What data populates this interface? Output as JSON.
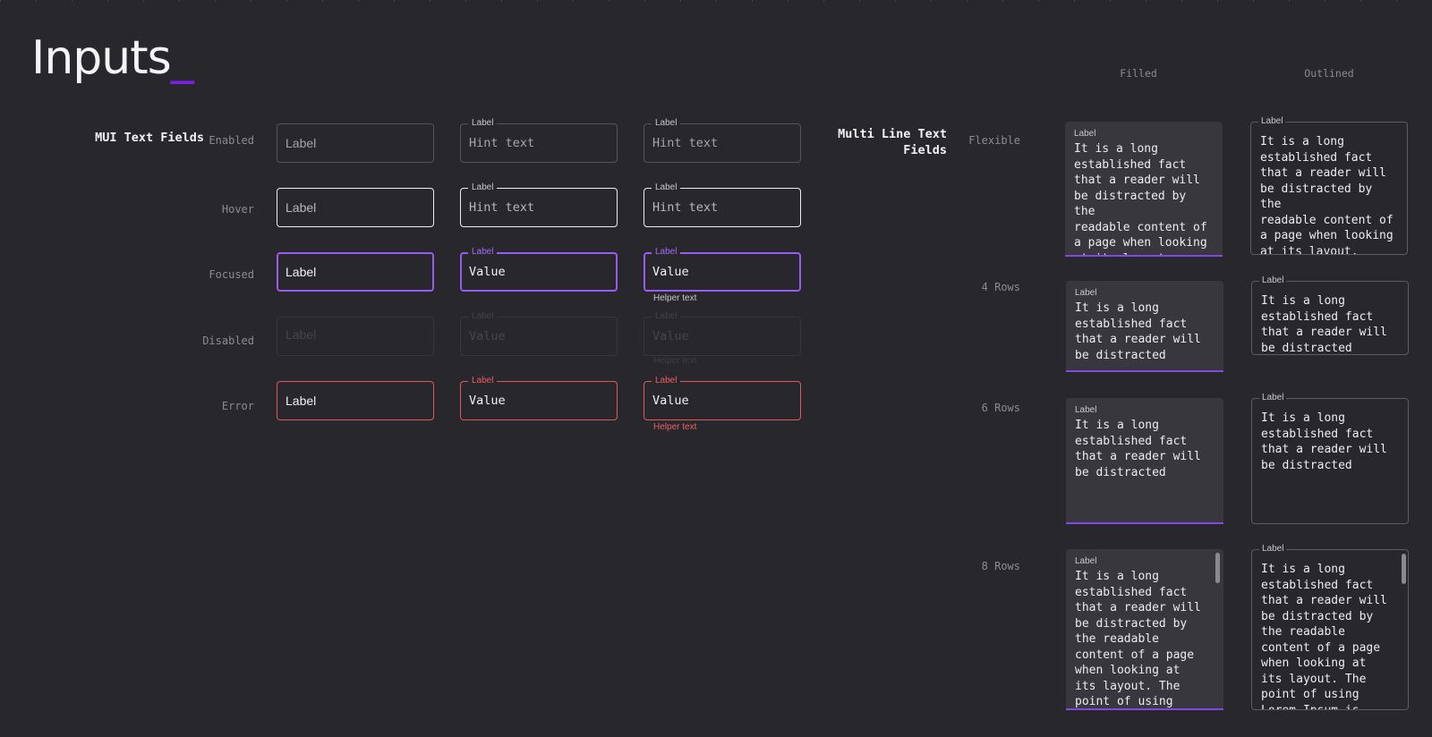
{
  "page": {
    "title": "Inputs",
    "title_cursor": "_"
  },
  "mui": {
    "section_title": "MUI Text Fields",
    "rows": [
      {
        "state": "Enabled",
        "fields": [
          "Label",
          "Hint text",
          "Hint text"
        ],
        "legend": "Label"
      },
      {
        "state": "Hover",
        "fields": [
          "Label",
          "Hint text",
          "Hint text"
        ],
        "legend": "Label"
      },
      {
        "state": "Focused",
        "fields": [
          "Label",
          "Value",
          "Value"
        ],
        "legend": "Label",
        "helper": "Helper text"
      },
      {
        "state": "Disabled",
        "fields": [
          "Label",
          "Value",
          "Value"
        ],
        "legend": "Label",
        "helper": "Helper text"
      },
      {
        "state": "Error",
        "fields": [
          "Label",
          "Value",
          "Value"
        ],
        "legend": "Label",
        "helper": "Helper text"
      }
    ]
  },
  "multiline": {
    "section_title_line1": "Multi Line Text",
    "section_title_line2": "Fields",
    "col_filled": "Filled",
    "col_outlined": "Outlined",
    "label": "Label",
    "rows": [
      {
        "name": "Flexible",
        "filled_text": "It is a long\nestablished fact\nthat a reader will\nbe distracted by the\nreadable content of\na page when looking\nat its layout.",
        "outlined_text": "It is a long\nestablished fact\nthat a reader will\nbe distracted by the\nreadable content of\na page when looking\nat its layout."
      },
      {
        "name": "4 Rows",
        "filled_text": "It is a long\nestablished fact\nthat a reader will\nbe distracted",
        "outlined_text": "It is a long\nestablished fact\nthat a reader will\nbe distracted"
      },
      {
        "name": "6 Rows",
        "filled_text": "It is a long\nestablished fact\nthat a reader will\nbe distracted",
        "outlined_text": "It is a long\nestablished fact\nthat a reader will\nbe distracted"
      },
      {
        "name": "8 Rows",
        "filled_text": "It is a long\nestablished fact\nthat a reader will\nbe distracted by\nthe readable\ncontent of a page\nwhen looking at\nits layout. The\npoint of using",
        "outlined_text": "It is a long\nestablished fact\nthat a reader will\nbe distracted by\nthe readable\ncontent of a page\nwhen looking at\nits layout. The\npoint of using\nLorem Ipsum is"
      }
    ]
  },
  "colors": {
    "background": "#28272c",
    "accent": "#7a1fe6",
    "focus": "#9a5cf0",
    "error": "#e0585b",
    "filled_bg": "#38373d"
  }
}
